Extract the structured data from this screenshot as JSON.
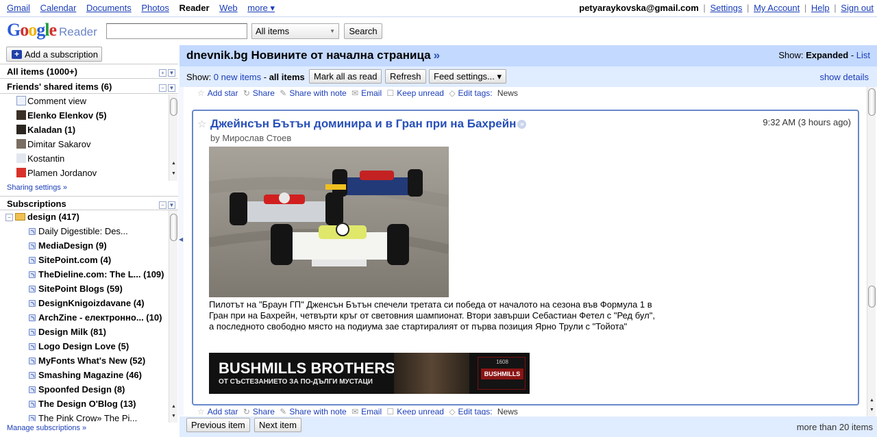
{
  "topnav": {
    "links": [
      "Gmail",
      "Calendar",
      "Documents",
      "Photos",
      "Reader",
      "Web",
      "more ▾"
    ],
    "current": "Reader",
    "email": "petyaraykovska@gmail.com",
    "settings": "Settings",
    "account": "My Account",
    "help": "Help",
    "signout": "Sign out"
  },
  "logo": {
    "google": "Google",
    "product": "Reader"
  },
  "search": {
    "value": "",
    "scope": "All items",
    "button": "Search"
  },
  "sidebar": {
    "add_subscription": "Add a subscription",
    "all_items": "All items (1000+)",
    "friends_header": "Friends' shared items (6)",
    "friends": [
      {
        "label": "Comment view",
        "bold": false
      },
      {
        "label": "Elenko Elenkov (5)",
        "bold": true
      },
      {
        "label": "Kaladan (1)",
        "bold": true
      },
      {
        "label": "Dimitar Sakarov",
        "bold": false
      },
      {
        "label": "Kostantin",
        "bold": false
      },
      {
        "label": "Plamen Jordanov",
        "bold": false
      }
    ],
    "sharing_settings": "Sharing settings »",
    "subscriptions_header": "Subscriptions",
    "folder": "design (417)",
    "feeds": [
      {
        "label": "Daily Digestible: Des...",
        "bold": false
      },
      {
        "label": "MediaDesign (9)",
        "bold": true
      },
      {
        "label": "SitePoint.com (4)",
        "bold": true
      },
      {
        "label": "TheDieline.com: The L... (109)",
        "bold": true
      },
      {
        "label": "SitePoint Blogs (59)",
        "bold": true
      },
      {
        "label": "DesignKnigoizdavane (4)",
        "bold": true
      },
      {
        "label": "ArchZine - електронно... (10)",
        "bold": true
      },
      {
        "label": "Design Milk (81)",
        "bold": true
      },
      {
        "label": "Logo Design Love (5)",
        "bold": true
      },
      {
        "label": "MyFonts What's New (52)",
        "bold": true
      },
      {
        "label": "Smashing Magazine (46)",
        "bold": true
      },
      {
        "label": "Spoonfed Design (8)",
        "bold": true
      },
      {
        "label": "The Design O'Blog (13)",
        "bold": true
      },
      {
        "label": "The Pink Crow» The Pi...",
        "bold": false
      }
    ],
    "manage": "Manage subscriptions »"
  },
  "main": {
    "feed_title": "dnevnik.bg Новините от начална страница",
    "title_arrow": "»",
    "show_label": "Show:",
    "show_expanded": "Expanded",
    "show_sep": " - ",
    "show_list": "List",
    "toolbar": {
      "show": "Show:",
      "new_items": "0 new items",
      "dash": " - ",
      "all_items": "all items",
      "mark_all_read": "Mark all as read",
      "refresh": "Refresh",
      "feed_settings": "Feed settings... ▾",
      "show_details": "show details"
    },
    "actions": {
      "add_star": "Add star",
      "share": "Share",
      "share_note": "Share with note",
      "email": "Email",
      "keep_unread": "Keep unread",
      "edit_tags": "Edit tags:",
      "tag": "News"
    },
    "entry": {
      "title": "Джейнсън Бътън доминира и в Гран при на Бахрейн",
      "time": "9:32 AM (3 hours ago)",
      "author": "by Мирослав Стоев",
      "body": "Пилотът на \"Браун ГП\" Дженсън Бътън спечели третата си победа от началото на сезона във Формула 1 в Гран при на Бахрейн, четвърти кръг от световния шампионат. Втори завърши Себастиан Фетел с \"Ред бул\", а последното свободно място на подиума зае стартиралият от първа позиция Ярно Трули с \"Тойота\"",
      "ad_title": "BUSHMILLS BROTHERS",
      "ad_subtitle": "ОТ СЪСТЕЗАНИЕТО ЗА ПО-ДЪЛГИ МУСТАЦИ",
      "ad_brand": "BUSHMILLS",
      "ad_year": "1608"
    },
    "prev_item": "Previous item",
    "next_item": "Next item",
    "item_count": "more than 20 items"
  },
  "colors": {
    "header_bg": "#c3d9ff",
    "toolbar_bg": "#e0ecff",
    "link": "#1a3db8",
    "entry_border": "#6688cc"
  }
}
